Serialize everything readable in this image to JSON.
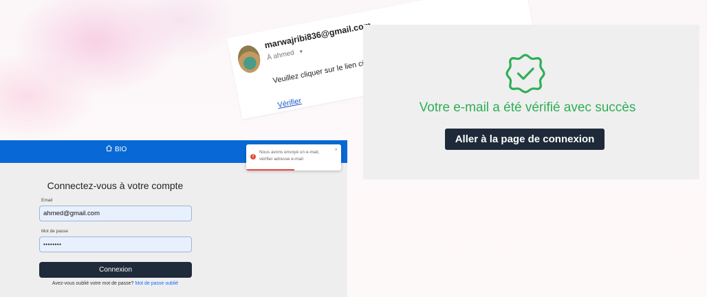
{
  "email": {
    "sender": "marwajribi836@gmail.com",
    "recipient": "À ahmed",
    "body": "Veuillez cliquer sur le lien ci-dessous pour vérifier votre adresse e-mail",
    "link_label": "Vérifier"
  },
  "navbar": {
    "brand": "BIO"
  },
  "toast": {
    "message": "Nous avons envoyé un e-mail, vérifier adresse e-mail",
    "close": "×"
  },
  "login": {
    "title": "Connectez-vous à votre compte",
    "email_label": "Email",
    "email_value": "ahmed@gmail.com",
    "password_label": "Mot de passe",
    "password_value": "••••••••",
    "submit_label": "Connexion",
    "forgot_text": "Avez-vous oublié votre mot de passe?",
    "forgot_link": "Mot de passe oublié"
  },
  "verified": {
    "message": "Votre e-mail a été vérifié avec succès",
    "button_label": "Aller à la page de connexion"
  },
  "colors": {
    "navbar": "#0869d6",
    "success": "#2fae57",
    "dark_button": "#1f2a3a",
    "error": "#e74c3c",
    "link": "#0d6efd"
  },
  "icons": [
    "home-icon",
    "error-icon",
    "close-icon",
    "dropdown-arrow-icon",
    "verified-badge-icon"
  ]
}
